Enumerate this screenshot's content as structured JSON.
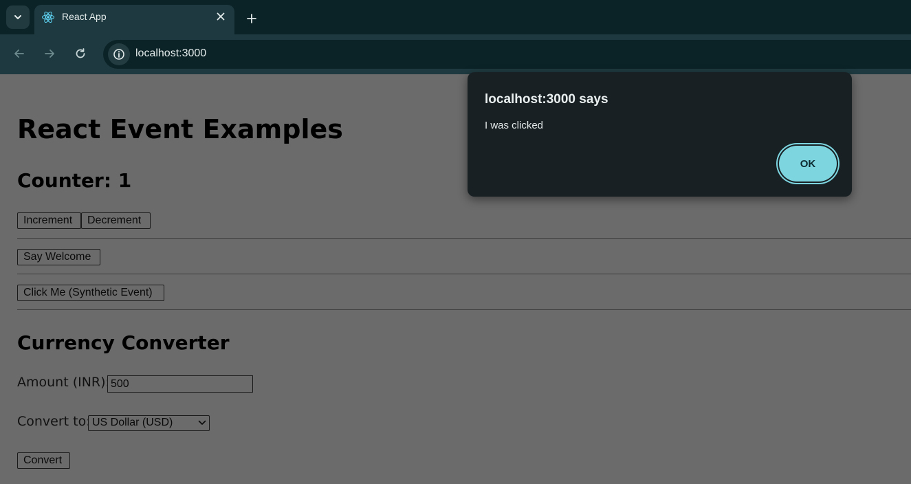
{
  "browser": {
    "tab": {
      "title": "React App"
    },
    "address_bar": {
      "url": "localhost:3000"
    }
  },
  "page": {
    "heading": "React Event Examples",
    "counter": {
      "label": "Counter: 1",
      "increment_label": "Increment",
      "decrement_label": "Decrement"
    },
    "say_welcome_label": "Say Welcome",
    "synthetic_event_label": "Click Me (Synthetic Event)",
    "currency": {
      "heading": "Currency Converter",
      "amount_label": "Amount (INR):",
      "amount_value": "500",
      "convert_to_label": "Convert to:",
      "selected_option": "US Dollar (USD)",
      "convert_label": "Convert"
    }
  },
  "dialog": {
    "title": "localhost:3000 says",
    "message": "I was clicked",
    "ok_label": "OK"
  },
  "colors": {
    "chrome_dark": "#0b2227",
    "chrome_mid": "#1e3a40",
    "page_dim": "#6b6b6b",
    "dialog_bg": "#182024",
    "accent": "#7dd5e0"
  }
}
